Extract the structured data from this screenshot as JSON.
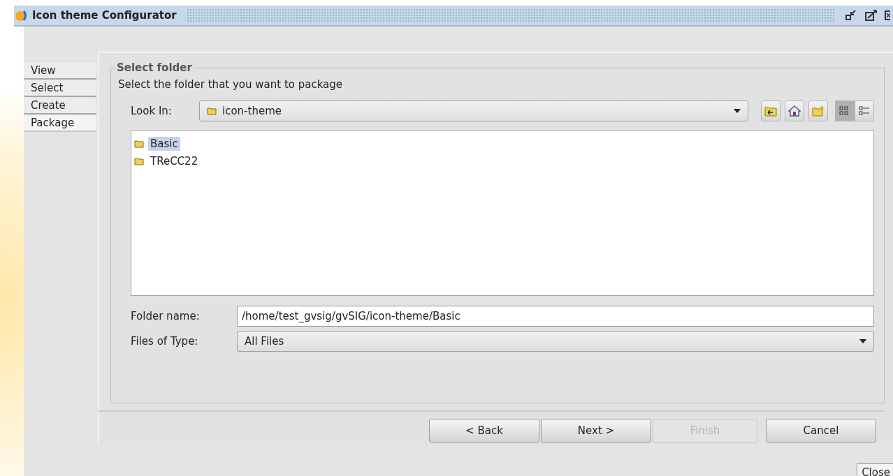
{
  "window": {
    "title": "Icon theme Configurator"
  },
  "tabs": [
    {
      "label": "View",
      "selected": false
    },
    {
      "label": "Select",
      "selected": false
    },
    {
      "label": "Create",
      "selected": false
    },
    {
      "label": "Package",
      "selected": true
    }
  ],
  "group": {
    "title": "Select folder",
    "instruction": "Select the folder that you want to package"
  },
  "look_in": {
    "label": "Look In:",
    "value": "icon-theme"
  },
  "view_toggles": [
    {
      "kind": "grid",
      "selected": true
    },
    {
      "kind": "details",
      "selected": false
    }
  ],
  "files": [
    {
      "name": "Basic",
      "selected": true
    },
    {
      "name": "TReCC22",
      "selected": false
    }
  ],
  "folder_name": {
    "label": "Folder name:",
    "value": "/home/test_gvsig/gvSIG/icon-theme/Basic"
  },
  "files_of_type": {
    "label": "Files of Type:",
    "value": "All Files"
  },
  "buttons": [
    {
      "label": "< Back",
      "disabled": false
    },
    {
      "label": "Next >",
      "disabled": false
    },
    {
      "label": "Finish",
      "disabled": true
    },
    {
      "label": "Cancel",
      "disabled": false
    }
  ],
  "close_button": "Close"
}
